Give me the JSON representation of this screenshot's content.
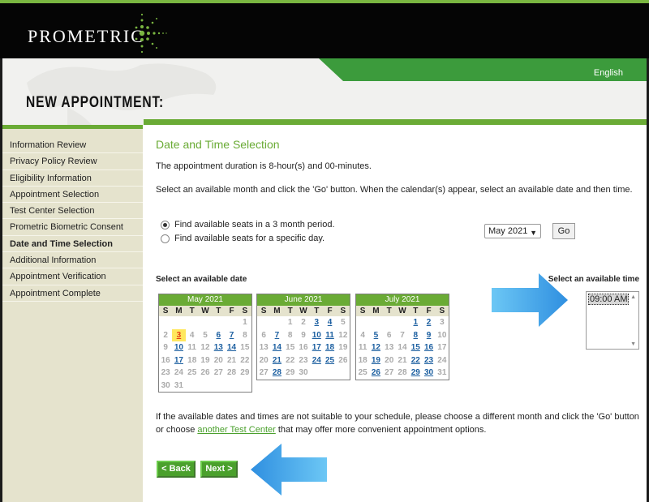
{
  "header": {
    "logo": "PROMETRIC",
    "language": "English",
    "page_title": "NEW APPOINTMENT:"
  },
  "sidebar": {
    "items": [
      {
        "label": "Information Review",
        "active": false
      },
      {
        "label": "Privacy Policy Review",
        "active": false
      },
      {
        "label": "Eligibility Information",
        "active": false
      },
      {
        "label": "Appointment Selection",
        "active": false
      },
      {
        "label": "Test Center Selection",
        "active": false
      },
      {
        "label": "Prometric Biometric Consent",
        "active": false
      },
      {
        "label": "Date and Time Selection",
        "active": true
      },
      {
        "label": "Additional Information",
        "active": false
      },
      {
        "label": "Appointment Verification",
        "active": false
      },
      {
        "label": "Appointment Complete",
        "active": false
      }
    ]
  },
  "main": {
    "title": "Date and Time Selection",
    "duration_text": "The appointment duration is 8-hour(s) and 00-minutes.",
    "instructions": "Select an available month and click the 'Go' button. When the calendar(s) appear, select an available date and then time.",
    "radio_3month": "Find available seats in a 3 month period.",
    "radio_specific": "Find available seats for a specific day.",
    "month_select_value": "May 2021",
    "go_label": "Go",
    "select_date_label": "Select an available date",
    "select_time_label": "Select an available time",
    "time_options": [
      "09:00 AM"
    ],
    "bottom_text_1": "If the available dates and times are not suitable to your schedule, please choose a different month and click the 'Go' button or choose ",
    "bottom_link": "another Test Center",
    "bottom_text_2": " that may offer more convenient appointment options.",
    "back_label": "< Back",
    "next_label": "Next >"
  },
  "calendar": {
    "weekdays": [
      "S",
      "M",
      "T",
      "W",
      "T",
      "F",
      "S"
    ],
    "months": [
      {
        "name": "May 2021",
        "weeks": [
          [
            "",
            "",
            "",
            "",
            "",
            "",
            "1"
          ],
          [
            "2",
            "3",
            "4",
            "5",
            "6",
            "7",
            "8"
          ],
          [
            "9",
            "10",
            "11",
            "12",
            "13",
            "14",
            "15"
          ],
          [
            "16",
            "17",
            "18",
            "19",
            "20",
            "21",
            "22"
          ],
          [
            "23",
            "24",
            "25",
            "26",
            "27",
            "28",
            "29"
          ],
          [
            "30",
            "31",
            "",
            "",
            "",
            "",
            ""
          ]
        ],
        "available": [
          "3",
          "6",
          "7",
          "10",
          "13",
          "14",
          "17"
        ],
        "selected": "3"
      },
      {
        "name": "June 2021",
        "weeks": [
          [
            "",
            "",
            "1",
            "2",
            "3",
            "4",
            "5"
          ],
          [
            "6",
            "7",
            "8",
            "9",
            "10",
            "11",
            "12"
          ],
          [
            "13",
            "14",
            "15",
            "16",
            "17",
            "18",
            "19"
          ],
          [
            "20",
            "21",
            "22",
            "23",
            "24",
            "25",
            "26"
          ],
          [
            "27",
            "28",
            "29",
            "30",
            "",
            "",
            ""
          ]
        ],
        "available": [
          "3",
          "4",
          "7",
          "10",
          "11",
          "14",
          "17",
          "18",
          "21",
          "24",
          "25",
          "28"
        ],
        "selected": ""
      },
      {
        "name": "July 2021",
        "weeks": [
          [
            "",
            "",
            "",
            "",
            "1",
            "2",
            "3"
          ],
          [
            "4",
            "5",
            "6",
            "7",
            "8",
            "9",
            "10"
          ],
          [
            "11",
            "12",
            "13",
            "14",
            "15",
            "16",
            "17"
          ],
          [
            "18",
            "19",
            "20",
            "21",
            "22",
            "23",
            "24"
          ],
          [
            "25",
            "26",
            "27",
            "28",
            "29",
            "30",
            "31"
          ]
        ],
        "available": [
          "1",
          "2",
          "5",
          "8",
          "9",
          "12",
          "15",
          "16",
          "19",
          "22",
          "23",
          "26",
          "29",
          "30"
        ],
        "selected": ""
      }
    ]
  },
  "colors": {
    "brand_green": "#6aab35",
    "link_blue": "#1c5fa0",
    "selected_bg": "#ffe75e",
    "annotation_arrow": "#4aa8ee"
  },
  "icons": {
    "logo_mark": "starburst-dots-icon",
    "annotation": "blue-arrow-icon"
  }
}
